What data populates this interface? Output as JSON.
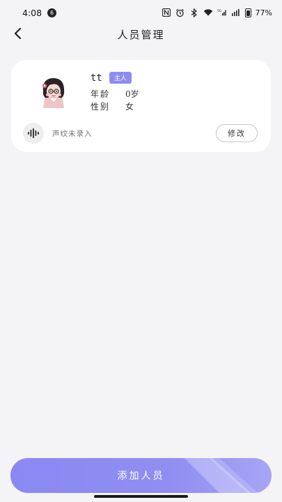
{
  "status_bar": {
    "time": "4:08",
    "notification_count": "6",
    "battery": "77%"
  },
  "header": {
    "title": "人员管理"
  },
  "person": {
    "name": "tt",
    "badge": "主人",
    "age_label": "年龄",
    "age_value": "0岁",
    "gender_label": "性别",
    "gender_value": "女",
    "voice_status": "声纹未录入",
    "edit_label": "修改"
  },
  "footer": {
    "add_label": "添加人员"
  },
  "colors": {
    "accent": "#8d8cf0",
    "background": "#f4f4f6"
  }
}
